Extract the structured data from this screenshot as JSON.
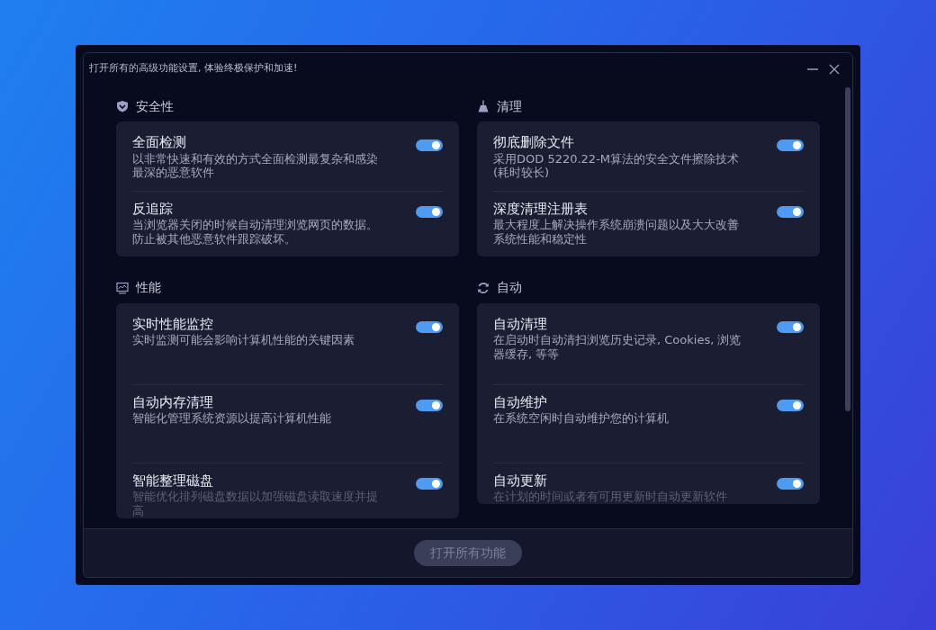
{
  "window": {
    "title": "打开所有的高级功能设置, 体验终极保护和加速!"
  },
  "sections": [
    {
      "title": "安全性",
      "items": [
        {
          "title": "全面检测",
          "description": "以非常快速和有效的方式全面检测最复杂和感染最深的恶意软件",
          "on": true
        },
        {
          "title": "反追踪",
          "description": "当浏览器关闭的时候自动清理浏览网页的数据。防止被其他恶意软件跟踪破坏。",
          "on": true
        }
      ]
    },
    {
      "title": "清理",
      "items": [
        {
          "title": "彻底删除文件",
          "description": "采用DOD 5220.22-M算法的安全文件擦除技术(耗时较长)",
          "on": true
        },
        {
          "title": "深度清理注册表",
          "description": "最大程度上解决操作系统崩溃问题以及大大改善系统性能和稳定性",
          "on": true
        }
      ]
    },
    {
      "title": "性能",
      "items": [
        {
          "title": "实时性能监控",
          "description": "实时监测可能会影响计算机性能的关键因素",
          "on": true
        },
        {
          "title": "自动内存清理",
          "description": "智能化管理系统资源以提高计算机性能",
          "on": true
        },
        {
          "title": "智能整理磁盘",
          "description": "智能优化排列磁盘数据以加强磁盘读取速度并提高",
          "on": true
        }
      ]
    },
    {
      "title": "自动",
      "items": [
        {
          "title": "自动清理",
          "description": "在启动时自动清扫浏览历史记录, Cookies, 浏览器缓存, 等等",
          "on": true
        },
        {
          "title": "自动维护",
          "description": "在系统空闲时自动维护您的计算机",
          "on": true
        },
        {
          "title": "自动更新",
          "description": "在计划的时间或者有可用更新时自动更新软件",
          "on": true
        }
      ]
    }
  ],
  "footer_button": {
    "label": "打开所有功能",
    "disabled": true
  }
}
